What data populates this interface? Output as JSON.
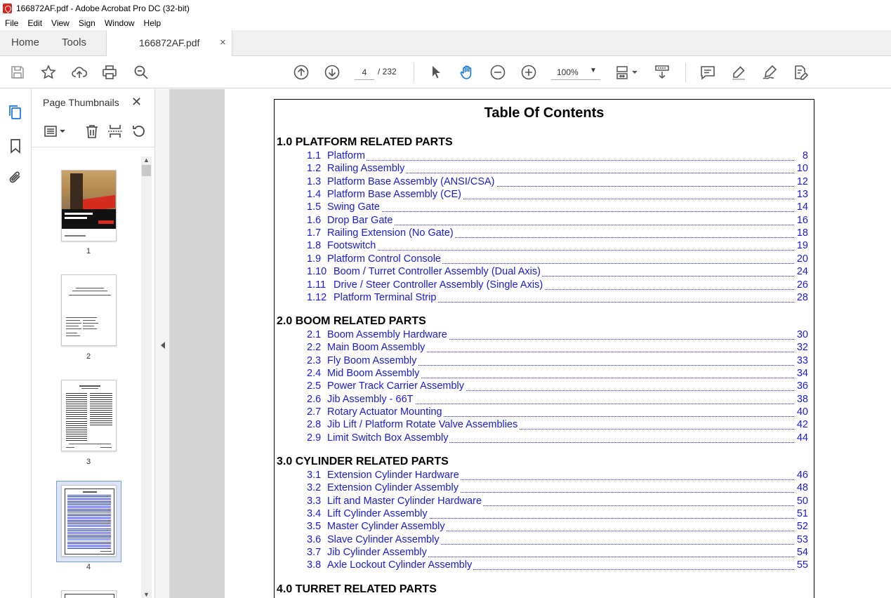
{
  "window": {
    "title": "166872AF.pdf - Adobe Acrobat Pro DC (32-bit)"
  },
  "menu": [
    "File",
    "Edit",
    "View",
    "Sign",
    "Window",
    "Help"
  ],
  "tabs": {
    "home": "Home",
    "tools": "Tools",
    "doc": "166872AF.pdf",
    "close": "×"
  },
  "toolbar": {
    "page_current": "4",
    "page_total": "/  232",
    "zoom": "100%"
  },
  "thumbnails": {
    "header": "Page Thumbnails",
    "close": "✕",
    "pages": [
      "1",
      "2",
      "3",
      "4"
    ]
  },
  "document": {
    "title": "Table Of Contents",
    "sections": [
      {
        "label": "1.0  PLATFORM RELATED PARTS",
        "entries": [
          {
            "n": "1.1",
            "t": "Platform",
            "p": "8"
          },
          {
            "n": "1.2",
            "t": "Railing Assembly",
            "p": "10"
          },
          {
            "n": "1.3",
            "t": "Platform Base Assembly (ANSI/CSA)",
            "p": "12"
          },
          {
            "n": "1.4",
            "t": "Platform Base Assembly (CE)",
            "p": "13"
          },
          {
            "n": "1.5",
            "t": "Swing Gate",
            "p": "14"
          },
          {
            "n": "1.6",
            "t": "Drop Bar Gate",
            "p": "16"
          },
          {
            "n": "1.7",
            "t": "Railing Extension (No Gate)",
            "p": "18"
          },
          {
            "n": "1.8",
            "t": "Footswitch",
            "p": "19"
          },
          {
            "n": "1.9",
            "t": "Platform Control Console",
            "p": "20"
          },
          {
            "n": "1.10",
            "t": "Boom / Turret Controller Assembly (Dual Axis)",
            "p": "24"
          },
          {
            "n": "1.11",
            "t": "Drive / Steer Controller Assembly (Single Axis)",
            "p": "26"
          },
          {
            "n": "1.12",
            "t": "Platform Terminal Strip",
            "p": "28"
          }
        ]
      },
      {
        "label": "2.0  BOOM RELATED PARTS",
        "entries": [
          {
            "n": "2.1",
            "t": "Boom Assembly Hardware",
            "p": "30"
          },
          {
            "n": "2.2",
            "t": "Main Boom Assembly",
            "p": "32"
          },
          {
            "n": "2.3",
            "t": "Fly Boom Assembly",
            "p": "33"
          },
          {
            "n": "2.4",
            "t": "Mid Boom Assembly",
            "p": "34"
          },
          {
            "n": "2.5",
            "t": "Power Track Carrier Assembly",
            "p": "36"
          },
          {
            "n": "2.6",
            "t": "Jib Assembly - 66T",
            "p": "38"
          },
          {
            "n": "2.7",
            "t": "Rotary Actuator Mounting",
            "p": "40"
          },
          {
            "n": "2.8",
            "t": "Jib Lift / Platform Rotate Valve Assemblies",
            "p": "42"
          },
          {
            "n": "2.9",
            "t": "Limit Switch Box Assembly",
            "p": "44"
          }
        ]
      },
      {
        "label": "3.0  CYLINDER RELATED PARTS",
        "entries": [
          {
            "n": "3.1",
            "t": "Extension Cylinder Hardware",
            "p": "46"
          },
          {
            "n": "3.2",
            "t": "Extension Cylinder Assembly",
            "p": "48"
          },
          {
            "n": "3.3",
            "t": "Lift and Master Cylinder Hardware",
            "p": "50"
          },
          {
            "n": "3.4",
            "t": "Lift Cylinder Assembly",
            "p": "51"
          },
          {
            "n": "3.5",
            "t": "Master Cylinder Assembly",
            "p": "52"
          },
          {
            "n": "3.6",
            "t": "Slave Cylinder Assembly",
            "p": "53"
          },
          {
            "n": "3.7",
            "t": "Jib Cylinder Assembly",
            "p": "54"
          },
          {
            "n": "3.8",
            "t": "Axle Lockout Cylinder Assembly",
            "p": "55"
          }
        ]
      },
      {
        "label": "4.0  TURRET RELATED PARTS",
        "entries": []
      }
    ]
  }
}
